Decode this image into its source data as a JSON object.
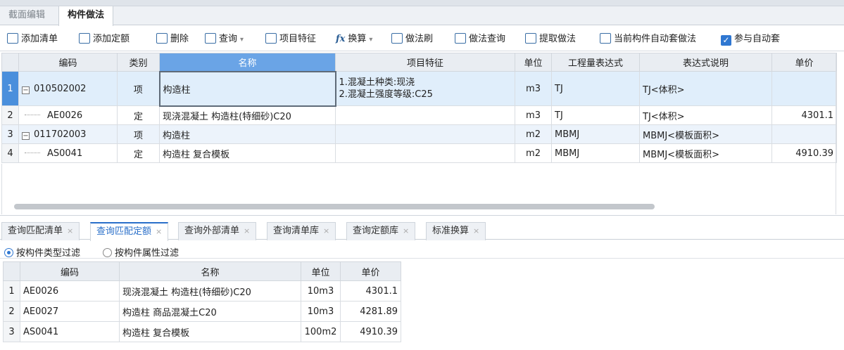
{
  "top_tabs": [
    "截面编辑",
    "构件做法"
  ],
  "toolbar": {
    "add_list": "添加清单",
    "add_quota": "添加定额",
    "delete": "删除",
    "query": "查询",
    "item_feature": "项目特征",
    "convert": "换算",
    "method_brush": "做法刷",
    "method_query": "做法查询",
    "extract_method": "提取做法",
    "auto_apply": "当前构件自动套做法",
    "participate_auto": "参与自动套"
  },
  "main_table": {
    "headers": [
      "编码",
      "类别",
      "名称",
      "项目特征",
      "单位",
      "工程量表达式",
      "表达式说明",
      "单价"
    ],
    "rows": [
      {
        "no": "1",
        "code": "010502002",
        "category": "项",
        "name": "构造柱",
        "feature_1": "1.混凝土种类:现浇",
        "feature_2": "2.混凝土强度等级:C25",
        "unit": "m3",
        "expr": "TJ",
        "expr_desc": "TJ<体积>",
        "price": ""
      },
      {
        "no": "2",
        "code": "AE0026",
        "category": "定",
        "name": "现浇混凝土 构造柱(特细砂)C20",
        "unit": "m3",
        "expr": "TJ",
        "expr_desc": "TJ<体积>",
        "price": "4301.1"
      },
      {
        "no": "3",
        "code": "011702003",
        "category": "项",
        "name": "构造柱",
        "unit": "m2",
        "expr": "MBMJ",
        "expr_desc": "MBMJ<模板面积>",
        "price": ""
      },
      {
        "no": "4",
        "code": "AS0041",
        "category": "定",
        "name": "构造柱 复合模板",
        "unit": "m2",
        "expr": "MBMJ",
        "expr_desc": "MBMJ<模板面积>",
        "price": "4910.39"
      }
    ]
  },
  "bottom_tabs": [
    "查询匹配清单",
    "查询匹配定额",
    "查询外部清单",
    "查询清单库",
    "查询定额库",
    "标准换算"
  ],
  "filter": {
    "by_type": "按构件类型过滤",
    "by_attr": "按构件属性过滤"
  },
  "sub_table": {
    "headers": [
      "编码",
      "名称",
      "单位",
      "单价"
    ],
    "rows": [
      {
        "no": "1",
        "code": "AE0026",
        "name": "现浇混凝土 构造柱(特细砂)C20",
        "unit": "10m3",
        "price": "4301.1"
      },
      {
        "no": "2",
        "code": "AE0027",
        "name": "构造柱 商品混凝土C20",
        "unit": "10m3",
        "price": "4281.89"
      },
      {
        "no": "3",
        "code": "AS0041",
        "name": "构造柱 复合模板",
        "unit": "100m2",
        "price": "4910.39"
      }
    ]
  },
  "colors": {
    "accent": "#2f77d1",
    "header_selected": "#6aa4e6",
    "row_selected": "#e0eefb"
  }
}
